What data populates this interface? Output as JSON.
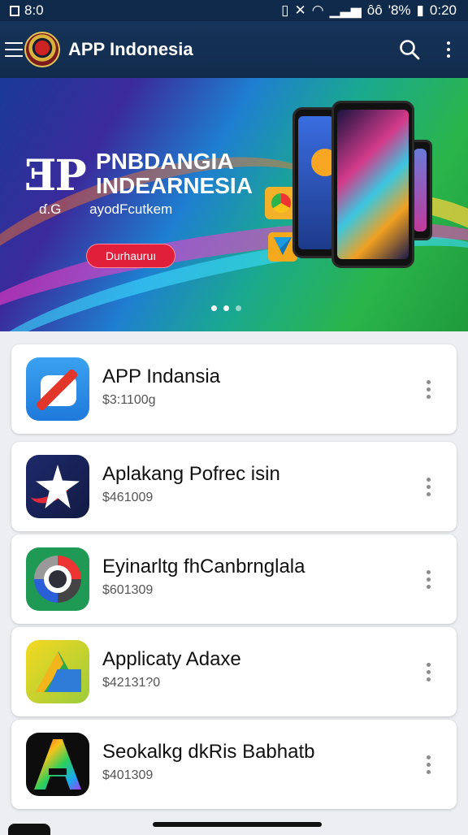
{
  "status_bar": {
    "left_text": "8:0",
    "right_text": "'8%",
    "time": "0:20",
    "carrier_text": "ôô"
  },
  "app_bar": {
    "title": "APP Indonesia",
    "icons": [
      "menu-icon",
      "logo",
      "search-icon",
      "more-vert-icon"
    ]
  },
  "banner": {
    "big_text": "ƎP",
    "title_line1": "PNBDANGIA",
    "title_line2": "INDEARNESIA",
    "sub_left": "ɗ.G",
    "sub_right": "ayodFcutkem",
    "button_label": "Durhauruı",
    "carousel_total": 3,
    "carousel_active": 1
  },
  "apps": [
    {
      "name": "APP Indansia",
      "price": "$3:1100g",
      "icon": "app-icon-blue-edit"
    },
    {
      "name": "Aplakang Pofrec isin",
      "price": "$461009",
      "icon": "app-icon-star"
    },
    {
      "name": "Eyinarltg fhCanbrnglala",
      "price": "$601309",
      "icon": "app-icon-chrome-like"
    },
    {
      "name": "Applicaty Adaxe",
      "price": "$42131?0",
      "icon": "app-icon-drive-like"
    },
    {
      "name": "Seokalkg dkRis Babhatb",
      "price": "$401309",
      "icon": "app-icon-a-rainbow"
    }
  ],
  "colors": {
    "app_bar": "#16345a",
    "status_bar": "#0f2a4a",
    "banner_button": "#e21f3b",
    "page_bg": "#eceef1"
  }
}
